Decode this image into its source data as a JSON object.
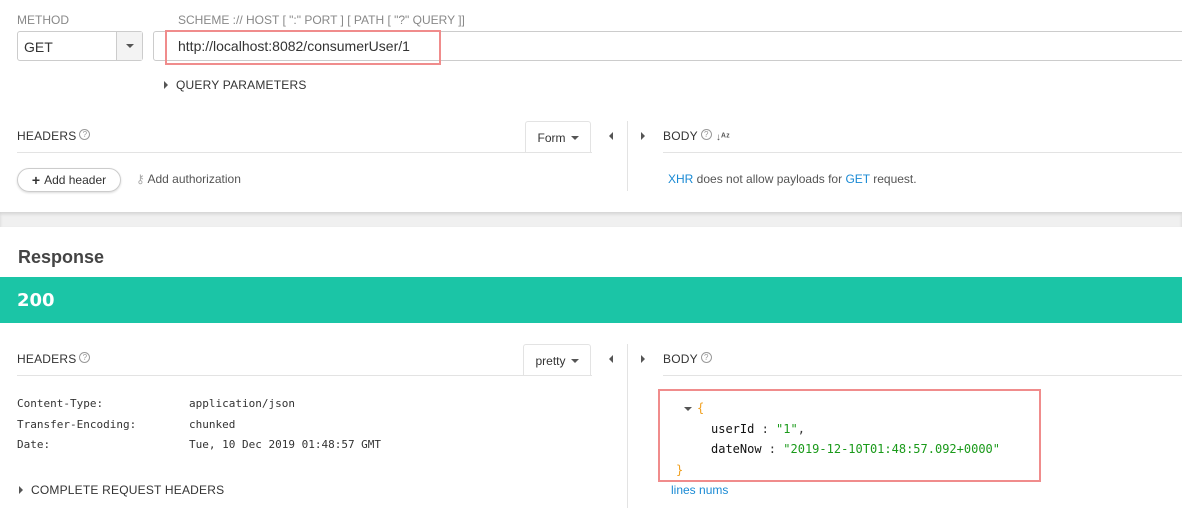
{
  "request": {
    "method_label": "METHOD",
    "method_value": "GET",
    "url_label": "SCHEME :// HOST [ \":\" PORT ] [ PATH [ \"?\" QUERY ]]",
    "url_value": "http://localhost:8082/consumerUser/1",
    "query_params": "QUERY PARAMETERS",
    "headers_label": "HEADERS",
    "headers_mode": "Form",
    "add_header": "Add header",
    "add_auth": "Add authorization",
    "body_label": "BODY",
    "body_msg": {
      "xhr": "XHR",
      "mid": " does not allow payloads for ",
      "get": "GET",
      "end": " request."
    }
  },
  "response": {
    "title": "Response",
    "status": "200",
    "status_color": "#1bc5a6",
    "headers_label": "HEADERS",
    "headers_mode": "pretty",
    "headers": [
      {
        "name": "Content-Type:",
        "value": "application/json"
      },
      {
        "name": "Transfer-Encoding:",
        "value": "chunked"
      },
      {
        "name": "Date:",
        "value": "Tue, 10 Dec 2019 01:48:57 GMT"
      }
    ],
    "complete_headers": "COMPLETE REQUEST HEADERS",
    "body_label": "BODY",
    "json": {
      "open": "{",
      "close": "}",
      "k1": "userId",
      "v1": "\"1\"",
      "k2": "dateNow",
      "v2": "\"2019-12-10T01:48:57.092+0000\""
    },
    "lines_nums": "lines nums"
  }
}
